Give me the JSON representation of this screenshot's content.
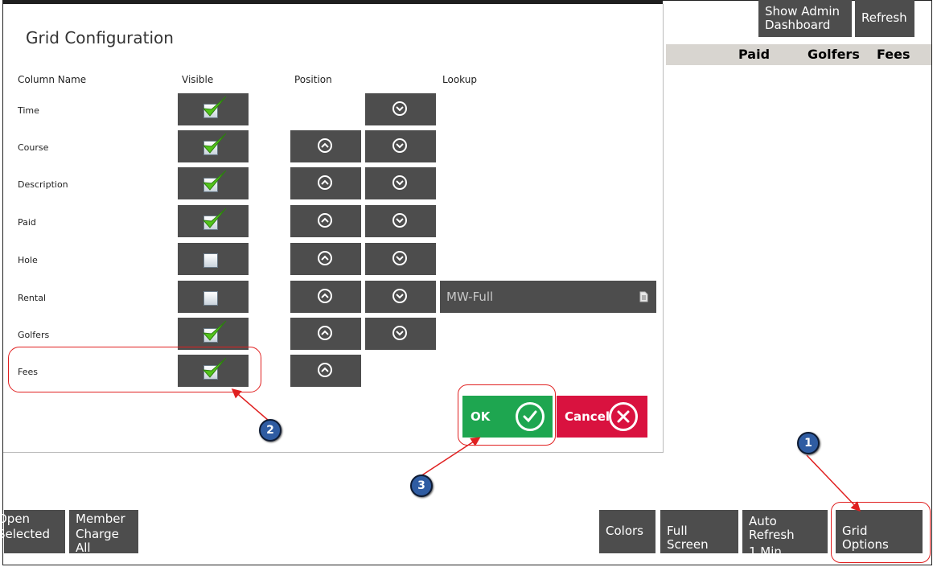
{
  "background_app": {
    "top_buttons": {
      "admin_dashboard": "Show Admin Dashboard",
      "refresh": "Refresh"
    },
    "grid_columns": [
      "Paid",
      "Golfers",
      "Fees"
    ],
    "bottom_left_buttons": [
      {
        "line1": "Open",
        "line2": "Selected"
      },
      {
        "line1": "Member",
        "line2": "Charge All"
      }
    ],
    "bottom_right_buttons": {
      "colors": "Colors",
      "full_screen": "Full Screen",
      "auto_refresh_line1": "Auto Refresh",
      "auto_refresh_line2": "1 Min",
      "grid_options": "Grid Options"
    }
  },
  "dialog": {
    "title": "Grid Configuration",
    "headers": {
      "column_name": "Column Name",
      "visible": "Visible",
      "position": "Position",
      "lookup": "Lookup"
    },
    "rows": [
      {
        "name": "Time",
        "visible": true,
        "can_move_up": false,
        "can_move_down": true
      },
      {
        "name": "Course",
        "visible": true,
        "can_move_up": true,
        "can_move_down": true
      },
      {
        "name": "Description",
        "visible": true,
        "can_move_up": true,
        "can_move_down": true
      },
      {
        "name": "Paid",
        "visible": true,
        "can_move_up": true,
        "can_move_down": true
      },
      {
        "name": "Hole",
        "visible": false,
        "can_move_up": true,
        "can_move_down": true
      },
      {
        "name": "Rental",
        "visible": false,
        "can_move_up": true,
        "can_move_down": true,
        "lookup": "MW-Full"
      },
      {
        "name": "Golfers",
        "visible": true,
        "can_move_up": true,
        "can_move_down": true
      },
      {
        "name": "Fees",
        "visible": true,
        "can_move_up": true,
        "can_move_down": false
      }
    ],
    "ok_label": "OK",
    "cancel_label": "Cancel"
  },
  "callouts": [
    "1",
    "2",
    "3"
  ],
  "colors": {
    "ok": "#1ea650",
    "cancel": "#d9123f",
    "tile": "#4d4d4d",
    "callout": "#2f5ca2",
    "annotation": "#e02020"
  }
}
